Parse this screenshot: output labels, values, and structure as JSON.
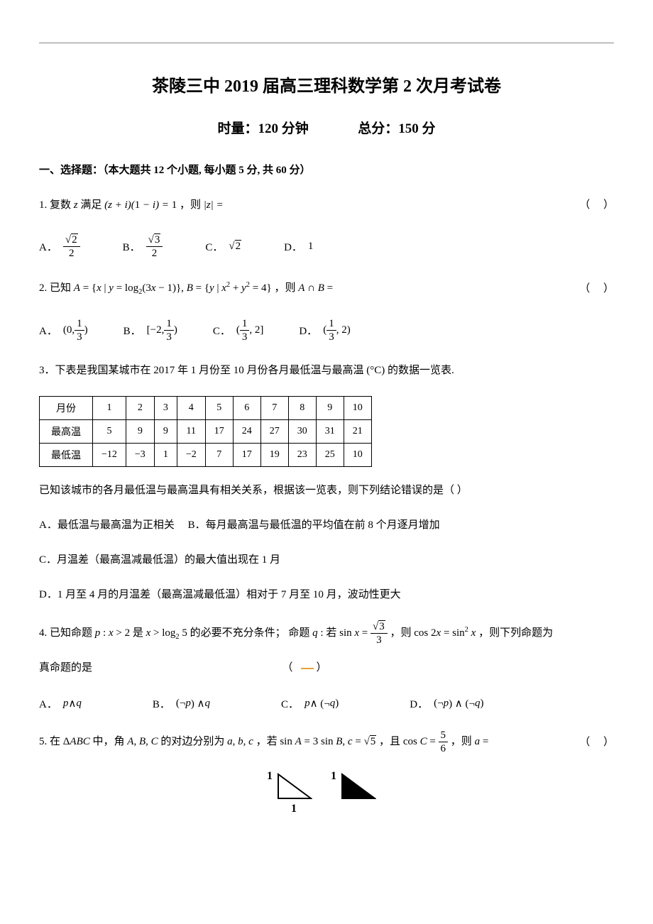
{
  "header": {
    "title": "茶陵三中 2019 届高三理科数学第 2 次月考试卷",
    "time_label": "时量：120 分钟",
    "score_label": "总分：150 分"
  },
  "section1": {
    "header": "一、选择题：（本大题共 12 个小题, 每小题 5 分, 共 60 分）"
  },
  "q1": {
    "num": "1.",
    "text_prefix": "复数",
    "text_mid": "满足",
    "formula": "(z + i)(1 − i) = 1",
    "text_suffix": "，则",
    "modz": "|z| =",
    "paren": "（     ）",
    "opts": {
      "a_label": "A．",
      "b_label": "B．",
      "c_label": "C．",
      "c_val": "2",
      "d_label": "D．",
      "d_val": "1"
    }
  },
  "q2": {
    "num": "2.",
    "text_prefix": "已知",
    "setA": "A = {x | y = log",
    "setA_sub": "2",
    "setA_tail": "(3x − 1)}, B = {y | x",
    "setB_sup": "2",
    "plus": " + y",
    "setB_sup2": "2",
    "eq4": " = 4}",
    "text_mid": "，则",
    "AintB": "A ∩ B =",
    "paren": "（     ）",
    "opts": {
      "a_label": "A．",
      "b_label": "B．",
      "c_label": "C．",
      "d_label": "D．"
    }
  },
  "q3": {
    "line1": "3．下表是我国某城市在 2017 年 1 月份至 10 月份各月最低温与最高温 (°C) 的数据一览表.",
    "table": {
      "headers": [
        "月份",
        "1",
        "2",
        "3",
        "4",
        "5",
        "6",
        "7",
        "8",
        "9",
        "10"
      ],
      "row1_label": "最高温",
      "row1": [
        "5",
        "9",
        "9",
        "11",
        "17",
        "24",
        "27",
        "30",
        "31",
        "21"
      ],
      "row2_label": "最低温",
      "row2": [
        "−12",
        "−3",
        "1",
        "−2",
        "7",
        "17",
        "19",
        "23",
        "25",
        "10"
      ]
    },
    "line2": "已知该城市的各月最低温与最高温具有相关关系，根据该一览表，则下列结论错误的是（     ）",
    "optA": "A．最低温与最高温为正相关",
    "optB": "B．每月最高温与最低温的平均值在前 8 个月逐月增加",
    "optC": "C．月温差（最高温减最低温）的最大值出现在 1 月",
    "optD": "D．1 月至 4 月的月温差（最高温减最低温）相对于 7 月至 10 月，波动性更大"
  },
  "q4": {
    "num": "4.",
    "text1": "已知命题",
    "p_expr": "p : x > 2",
    "text2": "是",
    "expr2": "x > log",
    "sub2": "2",
    "five": " 5",
    "text3": "的必要不充分条件；   命题",
    "q_expr": "q :",
    "text4": "若",
    "sin_eq": "sin x = ",
    "text5": "，则",
    "cos_eq": "cos 2x = sin",
    "sup2": "2",
    "x_text": " x",
    "text6": "，则下列命题为",
    "line2": "真命题的是",
    "paren_open": "（",
    "paren_close": "）",
    "opts": {
      "a_label": "A．",
      "a_val": "p ∧ q",
      "b_label": "B．",
      "b_val": "(¬p) ∧ q",
      "c_label": "C．",
      "c_val": "p ∧ (¬q)",
      "d_label": "D．",
      "d_val": "(¬p) ∧ (¬q)"
    }
  },
  "q5": {
    "num": "5.",
    "text1": "在",
    "tri": "ΔABC",
    "text2": "中，角",
    "abc1": "A, B, C",
    "text3": "的对边分别为",
    "abc2": "a, b, c",
    "text4": "，若",
    "sin_eq": "sin A = 3 sin B, c = ",
    "sqrt5": "5",
    "text5": "，且",
    "cos_eq": "cos C = ",
    "text6": "，则",
    "a_eq": "a =",
    "paren": "（     ）"
  },
  "triangles": {
    "top": "1",
    "bottom": "1"
  },
  "chart_data": {
    "type": "table",
    "title": "某城市2017年1-10月最低温与最高温 (°C)",
    "categories": [
      "1",
      "2",
      "3",
      "4",
      "5",
      "6",
      "7",
      "8",
      "9",
      "10"
    ],
    "series": [
      {
        "name": "最高温",
        "values": [
          5,
          9,
          9,
          11,
          17,
          24,
          27,
          30,
          31,
          21
        ]
      },
      {
        "name": "最低温",
        "values": [
          -12,
          -3,
          1,
          -2,
          7,
          17,
          19,
          23,
          25,
          10
        ]
      }
    ]
  }
}
